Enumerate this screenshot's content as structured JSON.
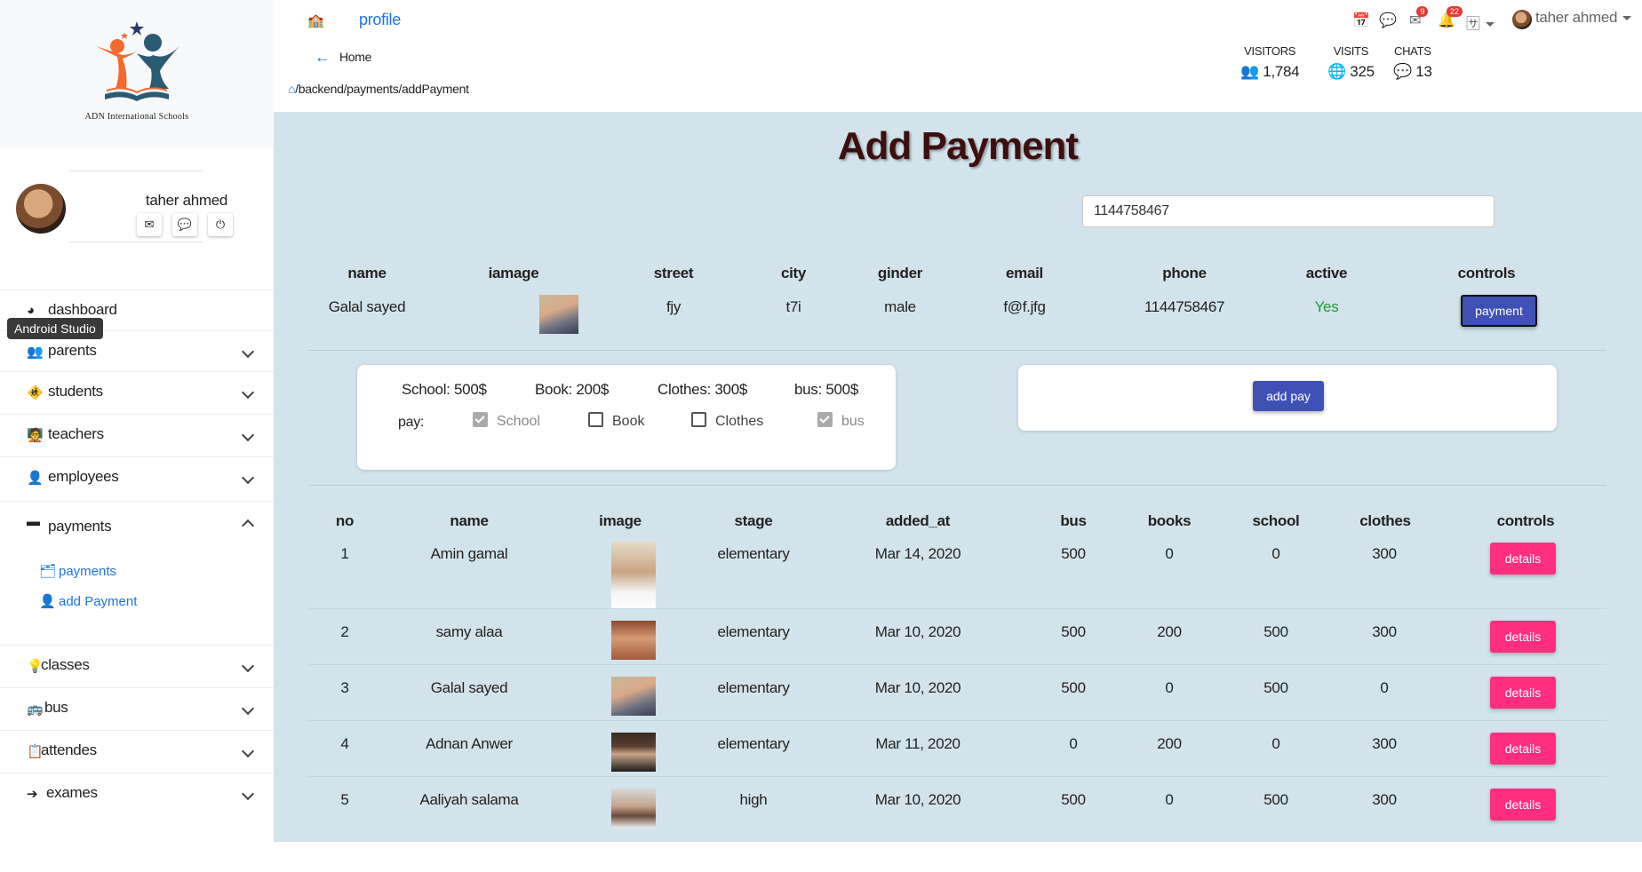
{
  "brand": {
    "school_name": "ADN International Schools"
  },
  "user": {
    "name": "taher ahmed"
  },
  "tooltip": {
    "text": "Android Studio"
  },
  "sidebar": {
    "items": [
      {
        "label": "dashboard"
      },
      {
        "label": "parents"
      },
      {
        "label": "students"
      },
      {
        "label": "teachers"
      },
      {
        "label": "employees"
      },
      {
        "label": "payments"
      },
      {
        "label": "classes"
      },
      {
        "label": "bus"
      },
      {
        "label": "attendes"
      },
      {
        "label": "exames"
      }
    ],
    "payments_sub": [
      {
        "label": "payments"
      },
      {
        "label": "add Payment"
      }
    ]
  },
  "topbar": {
    "profile": "profile",
    "messages_badge": "9",
    "notifications_badge": "22",
    "user_name": "taher ahmed"
  },
  "breadcrumb": {
    "home": "Home",
    "path": "/backend/payments/addPayment"
  },
  "stats": [
    {
      "label": "VISITORS",
      "value": "1,784"
    },
    {
      "label": "VISITS",
      "value": "325"
    },
    {
      "label": "CHATS",
      "value": "13"
    }
  ],
  "page": {
    "title": "Add Payment",
    "search_value": "1144758467"
  },
  "parent_table": {
    "headers": [
      "name",
      "iamage",
      "street",
      "city",
      "ginder",
      "email",
      "phone",
      "active",
      "controls"
    ],
    "row": {
      "name": "Galal sayed",
      "street": "fjy",
      "city": "t7i",
      "gender": "male",
      "email": "f@f.jfg",
      "phone": "1144758467",
      "active": "Yes",
      "button": "payment"
    }
  },
  "fees": {
    "school": "School: 500$",
    "book": "Book: 200$",
    "clothes": "Clothes: 300$",
    "bus": "bus: 500$",
    "pay_label": "pay:",
    "options": [
      {
        "label": "School",
        "checked": true,
        "disabled": true
      },
      {
        "label": "Book",
        "checked": false,
        "disabled": false
      },
      {
        "label": "Clothes",
        "checked": false,
        "disabled": false
      },
      {
        "label": "bus",
        "checked": true,
        "disabled": true
      }
    ],
    "add_button": "add pay"
  },
  "payments_table": {
    "headers": [
      "no",
      "name",
      "image",
      "stage",
      "added_at",
      "bus",
      "books",
      "school",
      "clothes",
      "controls"
    ],
    "rows": [
      {
        "no": "1",
        "name": "Amin gamal",
        "stage": "elementary",
        "added_at": "Mar 14, 2020",
        "bus": "500",
        "books": "0",
        "school": "0",
        "clothes": "300",
        "button": "details"
      },
      {
        "no": "2",
        "name": "samy alaa",
        "stage": "elementary",
        "added_at": "Mar 10, 2020",
        "bus": "500",
        "books": "200",
        "school": "500",
        "clothes": "300",
        "button": "details"
      },
      {
        "no": "3",
        "name": "Galal sayed",
        "stage": "elementary",
        "added_at": "Mar 10, 2020",
        "bus": "500",
        "books": "0",
        "school": "500",
        "clothes": "0",
        "button": "details"
      },
      {
        "no": "4",
        "name": "Adnan Anwer",
        "stage": "elementary",
        "added_at": "Mar 11, 2020",
        "bus": "0",
        "books": "200",
        "school": "0",
        "clothes": "300",
        "button": "details"
      },
      {
        "no": "5",
        "name": "Aaliyah salama",
        "stage": "high",
        "added_at": "Mar 10, 2020",
        "bus": "500",
        "books": "0",
        "school": "500",
        "clothes": "300",
        "button": "details"
      }
    ]
  },
  "colors": {
    "accent": "#1e73e8",
    "primary_button": "#3f51b5",
    "danger_button": "#ff2e7e",
    "content_bg": "#d2e3ec",
    "title": "#3d0f0f",
    "active_yes": "#1e9a2f"
  }
}
